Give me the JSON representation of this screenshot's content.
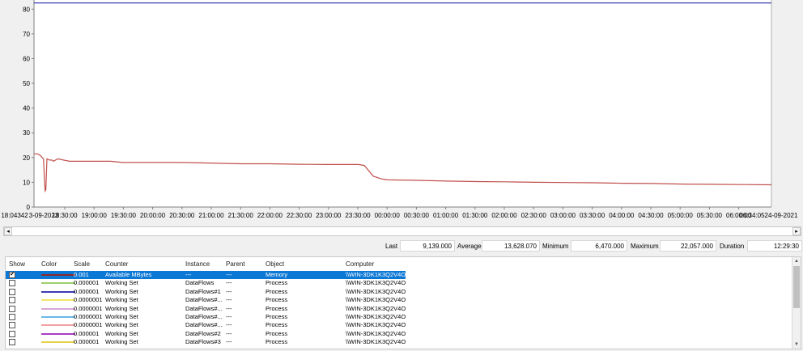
{
  "chart_data": {
    "type": "line",
    "ylim": [
      0,
      85
    ],
    "y_ticks": [
      "0",
      "10",
      "20",
      "30",
      "40",
      "50",
      "60",
      "70",
      "80"
    ],
    "x_ticks": [
      "18:04342",
      "3-09-2023",
      "18:30:00",
      "19:00:00",
      "19:30:00",
      "20:00:00",
      "20:30:00",
      "21:00:00",
      "21:30:00",
      "22:00:00",
      "22:30:00",
      "23:00:00",
      "23:30:00",
      "00:00:00",
      "00:30:00",
      "01:00:00",
      "01:30:00",
      "02:00:00",
      "02:30:00",
      "03:00:00",
      "03:30:00",
      "04:00:00",
      "04:30:00",
      "05:00:00",
      "05:30:00",
      "06:00:00",
      "06:34:05",
      "24-09-2021"
    ],
    "grid": false,
    "series": [
      {
        "color": "#3b3bb3",
        "x": [
          0,
          12.5
        ],
        "y": [
          82.5,
          82.5
        ]
      },
      {
        "color": "#c0504d",
        "x": [
          0,
          0.06,
          0.1,
          0.12,
          0.16,
          0.18,
          0.19,
          0.2,
          0.22,
          0.26,
          0.3,
          0.33,
          0.4,
          0.6,
          1.0,
          1.3,
          1.5,
          2.0,
          2.5,
          3.0,
          3.5,
          4.0,
          4.5,
          5.0,
          5.5,
          5.6,
          5.75,
          5.9,
          6.0,
          6.5,
          7.0,
          7.5,
          8.0,
          8.5,
          9.0,
          9.5,
          10.0,
          10.5,
          11.0,
          11.5,
          12.0,
          12.5
        ],
        "y": [
          21.5,
          21.5,
          21,
          20.5,
          19.5,
          10,
          6.5,
          7,
          19.5,
          19,
          19,
          18.5,
          19.5,
          18.5,
          18.5,
          18.5,
          18,
          18,
          18,
          17.8,
          17.5,
          17.5,
          17.3,
          17.2,
          17.2,
          16.8,
          12.5,
          11.3,
          11,
          10.8,
          10.5,
          10.3,
          10.2,
          10,
          9.9,
          9.8,
          9.6,
          9.5,
          9.3,
          9.2,
          9.1,
          9
        ]
      }
    ]
  },
  "stats": {
    "last_label": "Last",
    "last_value": "9,139.000",
    "average_label": "Average",
    "average_value": "13,628.070",
    "minimum_label": "Minimum",
    "minimum_value": "6,470.000",
    "maximum_label": "Maximum",
    "maximum_value": "22,057.000",
    "duration_label": "Duration",
    "duration_value": "12:29:30"
  },
  "scrollbar": {
    "left_arrow": "◂",
    "right_arrow": "▸",
    "up_arrow": "▲",
    "down_arrow": "▼"
  },
  "legend": {
    "headers": {
      "show": "Show",
      "color": "Color",
      "scale": "Scale",
      "counter": "Counter",
      "instance": "Instance",
      "parent": "Parent",
      "object": "Object",
      "computer": "Computer"
    },
    "rows": [
      {
        "checked": true,
        "check_mark": "✔",
        "color": "#8b2a2a",
        "scale": "0.001",
        "counter": "Available MBytes",
        "instance": "---",
        "parent": "---",
        "object": "Memory",
        "computer": "\\\\WIN-3DK1K3Q2V4O",
        "selected": true
      },
      {
        "checked": false,
        "check_mark": "",
        "color": "#9ecf6a",
        "scale": "0.000001",
        "counter": "Working Set",
        "instance": "DataFlows",
        "parent": "---",
        "object": "Process",
        "computer": "\\\\WIN-3DK1K3Q2V4O",
        "selected": false
      },
      {
        "checked": false,
        "check_mark": "",
        "color": "#3b3bb3",
        "scale": "0.000001",
        "counter": "Working Set",
        "instance": "DataFlows#1",
        "parent": "---",
        "object": "Process",
        "computer": "\\\\WIN-3DK1K3Q2V4O",
        "selected": false
      },
      {
        "checked": false,
        "check_mark": "",
        "color": "#f2e66b",
        "scale": "0.0000001",
        "counter": "Working Set",
        "instance": "DataFlows#...",
        "parent": "---",
        "object": "Process",
        "computer": "\\\\WIN-3DK1K3Q2V4O",
        "selected": false
      },
      {
        "checked": false,
        "check_mark": "",
        "color": "#d7a7d7",
        "scale": "0.0000001",
        "counter": "Working Set",
        "instance": "DataFlows#...",
        "parent": "---",
        "object": "Process",
        "computer": "\\\\WIN-3DK1K3Q2V4O",
        "selected": false
      },
      {
        "checked": false,
        "check_mark": "",
        "color": "#6ab8e6",
        "scale": "0.0000001",
        "counter": "Working Set",
        "instance": "DataFlows#...",
        "parent": "---",
        "object": "Process",
        "computer": "\\\\WIN-3DK1K3Q2V4O",
        "selected": false
      },
      {
        "checked": false,
        "check_mark": "",
        "color": "#f2a0a0",
        "scale": "0.0000001",
        "counter": "Working Set",
        "instance": "DataFlows#...",
        "parent": "---",
        "object": "Process",
        "computer": "\\\\WIN-3DK1K3Q2V4O",
        "selected": false
      },
      {
        "checked": false,
        "check_mark": "",
        "color": "#a83cc8",
        "scale": "0.000001",
        "counter": "Working Set",
        "instance": "DataFlows#2",
        "parent": "---",
        "object": "Process",
        "computer": "\\\\WIN-3DK1K3Q2V4O",
        "selected": false
      },
      {
        "checked": false,
        "check_mark": "",
        "color": "#e6d24a",
        "scale": "0.000001",
        "counter": "Working Set",
        "instance": "DataFlows#3",
        "parent": "---",
        "object": "Process",
        "computer": "\\\\WIN-3DK1K3Q2V4O",
        "selected": false
      }
    ]
  }
}
